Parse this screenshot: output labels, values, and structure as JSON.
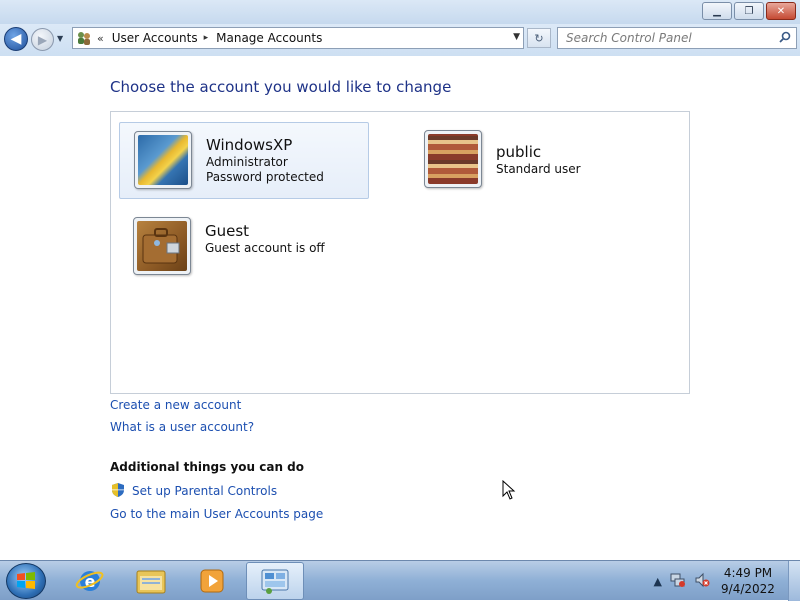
{
  "window": {
    "buttons": {
      "minimize": "▁",
      "maximize": "❐",
      "close": "✕"
    }
  },
  "nav": {
    "back": "◀",
    "forward": "▶",
    "history_dropdown": "▼",
    "breadcrumb_chevron": "«",
    "breadcrumbs": [
      "User Accounts",
      "Manage Accounts"
    ],
    "breadcrumb_separator": "▸",
    "address_dropdown": "▼",
    "refresh": "↻",
    "search_placeholder": "Search Control Panel",
    "search_icon": "⚲"
  },
  "main": {
    "heading": "Choose the account you would like to change",
    "accounts": [
      {
        "name": "WindowsXP",
        "lines": [
          "Administrator",
          "Password protected"
        ],
        "selected": true,
        "icon": "user-picture-flower"
      },
      {
        "name": "public",
        "lines": [
          "Standard user"
        ],
        "selected": false,
        "icon": "user-picture-stripes"
      },
      {
        "name": "Guest",
        "lines": [
          "Guest account is off"
        ],
        "selected": false,
        "icon": "user-picture-briefcase"
      }
    ],
    "links": {
      "create": "Create a new account",
      "what_is": "What is a user account?"
    },
    "additional": {
      "heading": "Additional things you can do",
      "parental_controls": "Set up Parental Controls",
      "main_page": "Go to the main User Accounts page"
    }
  },
  "taskbar": {
    "start_glyph": "⊞",
    "pinned": [
      {
        "name": "internet-explorer",
        "glyph": "e"
      },
      {
        "name": "windows-explorer",
        "glyph": "▤"
      },
      {
        "name": "media-player",
        "glyph": "▶"
      },
      {
        "name": "control-panel",
        "glyph": "▦",
        "active": true
      }
    ],
    "tray": {
      "show_hidden": "▲",
      "network": "⛌",
      "volume": "✕"
    },
    "clock": {
      "time": "4:49 PM",
      "date": "9/4/2022"
    }
  },
  "colors": {
    "heading": "#1e3287",
    "link": "#1c4fb0"
  }
}
